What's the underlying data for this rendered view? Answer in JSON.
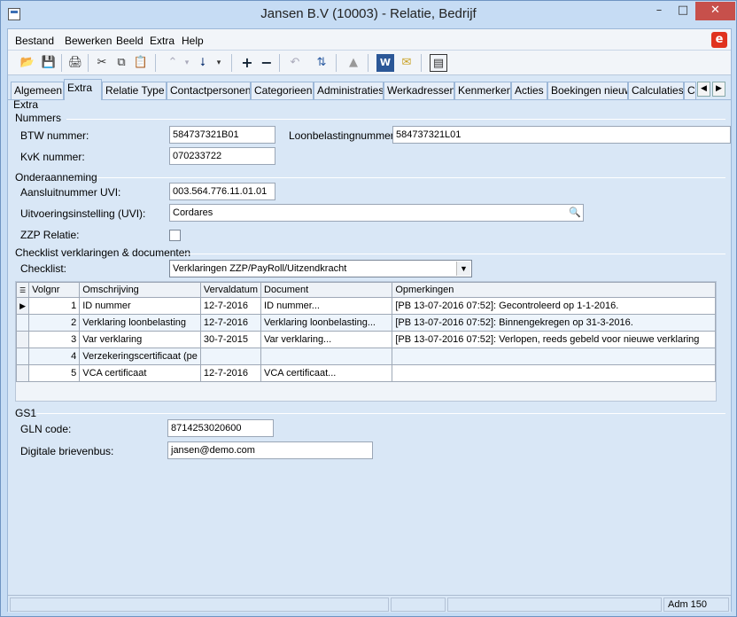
{
  "window": {
    "title": "Jansen B.V (10003) - Relatie, Bedrijf"
  },
  "menu": [
    "Bestand",
    "Bewerken",
    "Beeld",
    "Extra",
    "Help"
  ],
  "tabs": [
    "Algemeen",
    "Extra",
    "Relatie Type",
    "Contactpersonen",
    "Categorieen",
    "Administraties",
    "Werkadressen",
    "Kenmerken",
    "Acties",
    "Boekingen nieuw",
    "Calculaties",
    "C"
  ],
  "active_tab": "Extra",
  "section_title": "Extra",
  "nummers": {
    "title": "Nummers",
    "btw_label": "BTW nummer:",
    "btw_value": "584737321B01",
    "loon_label": "Loonbelastingnummer:",
    "loon_value": "584737321L01",
    "kvk_label": "KvK nummer:",
    "kvk_value": "070233722"
  },
  "onderaanneming": {
    "title": "Onderaanneming",
    "uvi_label": "Aansluitnummer UVI:",
    "uvi_value": "003.564.776.11.01.01",
    "instelling_label": "Uitvoeringsinstelling (UVI):",
    "instelling_value": "Cordares",
    "zzp_label": "ZZP Relatie:",
    "zzp_checked": false
  },
  "checklist": {
    "title": "Checklist verklaringen & documenten",
    "checklist_label": "Checklist:",
    "checklist_value": "Verklaringen ZZP/PayRoll/Uitzendkracht",
    "columns": [
      "Volgnr",
      "Omschrijving",
      "Vervaldatum",
      "Document",
      "Opmerkingen"
    ],
    "rows": [
      {
        "volgnr": "1",
        "omschrijving": "ID nummer",
        "vervaldatum": "12-7-2016",
        "document": "ID nummer...",
        "opmerkingen": "[PB 13-07-2016 07:52]:  Gecontroleerd op 1-1-2016."
      },
      {
        "volgnr": "2",
        "omschrijving": "Verklaring loonbelasting",
        "vervaldatum": "12-7-2016",
        "document": "Verklaring loonbelasting...",
        "opmerkingen": "[PB 13-07-2016 07:52]:  Binnengekregen op 31-3-2016."
      },
      {
        "volgnr": "3",
        "omschrijving": "Var verklaring",
        "vervaldatum": "30-7-2015",
        "document": "Var verklaring...",
        "opmerkingen": "[PB 13-07-2016 07:52]:  Verlopen, reeds gebeld voor nieuwe verklaring"
      },
      {
        "volgnr": "4",
        "omschrijving": "Verzekeringscertificaat (pe",
        "vervaldatum": "",
        "document": "",
        "opmerkingen": ""
      },
      {
        "volgnr": "5",
        "omschrijving": "VCA certificaat",
        "vervaldatum": "12-7-2016",
        "document": "VCA certificaat...",
        "opmerkingen": ""
      }
    ]
  },
  "gs1": {
    "title": "GS1",
    "gln_label": "GLN code:",
    "gln_value": "8714253020600",
    "brievenbus_label": "Digitale brievenbus:",
    "brievenbus_value": "jansen@demo.com"
  },
  "status": {
    "user": "Adm 150"
  },
  "colors": {
    "accent": "#3c6fb4",
    "brand": "#e0321e",
    "close": "#c7504b"
  }
}
